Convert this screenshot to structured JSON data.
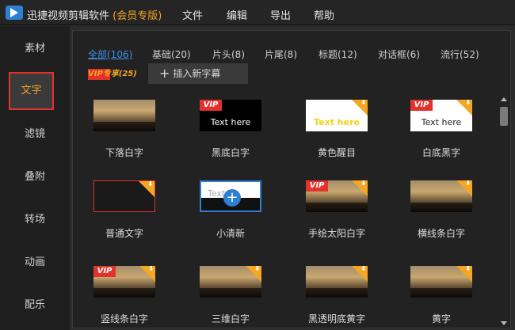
{
  "app": {
    "title": "迅捷视频剪辑软件",
    "edition": "(会员专版)"
  },
  "menu": [
    "文件",
    "编辑",
    "导出",
    "帮助"
  ],
  "sidebar": {
    "items": [
      "素材",
      "文字",
      "滤镜",
      "叠附",
      "转场",
      "动画",
      "配乐"
    ],
    "active_index": 1
  },
  "tabs": {
    "row1": [
      "全部(106)",
      "基础(20)",
      "片头(8)",
      "片尾(8)",
      "标题(12)",
      "对话框(6)",
      "流行(52)"
    ],
    "vip": "VIP专享(25)",
    "insert_button": "插入新字幕"
  },
  "tiles": [
    {
      "label": "下落白字",
      "style": "photo",
      "caption": "",
      "vip": false,
      "download": false
    },
    {
      "label": "黑底白字",
      "style": "black",
      "caption": "Text here",
      "vip": true,
      "download": false
    },
    {
      "label": "黄色醒目",
      "style": "white",
      "caption": "Text here",
      "vip": false,
      "download": true
    },
    {
      "label": "白底黑字",
      "style": "white",
      "caption": "Text here",
      "vip": true,
      "download": true
    },
    {
      "label": "普通文字",
      "style": "dark",
      "caption": "",
      "vip": false,
      "download": true
    },
    {
      "label": "小清新",
      "style": "selected",
      "caption": "Text",
      "vip": false,
      "download": false
    },
    {
      "label": "手绘太阳白字",
      "style": "photo",
      "caption": "",
      "vip": true,
      "download": true
    },
    {
      "label": "横线条白字",
      "style": "photo",
      "caption": "",
      "vip": false,
      "download": true
    },
    {
      "label": "竖线条白字",
      "style": "photo",
      "caption": "",
      "vip": true,
      "download": true
    },
    {
      "label": "三维白字",
      "style": "photo",
      "caption": "",
      "vip": false,
      "download": true
    },
    {
      "label": "黑透明底黄字",
      "style": "photo",
      "caption": "",
      "vip": false,
      "download": true
    },
    {
      "label": "黄字",
      "style": "photo",
      "caption": "",
      "vip": false,
      "download": true
    }
  ],
  "badges": {
    "vip": "VIP",
    "download_icon": "download-icon",
    "add_icon": "plus-icon"
  },
  "colors": {
    "accent": "#f5a623",
    "vip_red": "#e3322b",
    "link_blue": "#3c8ee8",
    "selected_blue": "#2d7fd3"
  }
}
